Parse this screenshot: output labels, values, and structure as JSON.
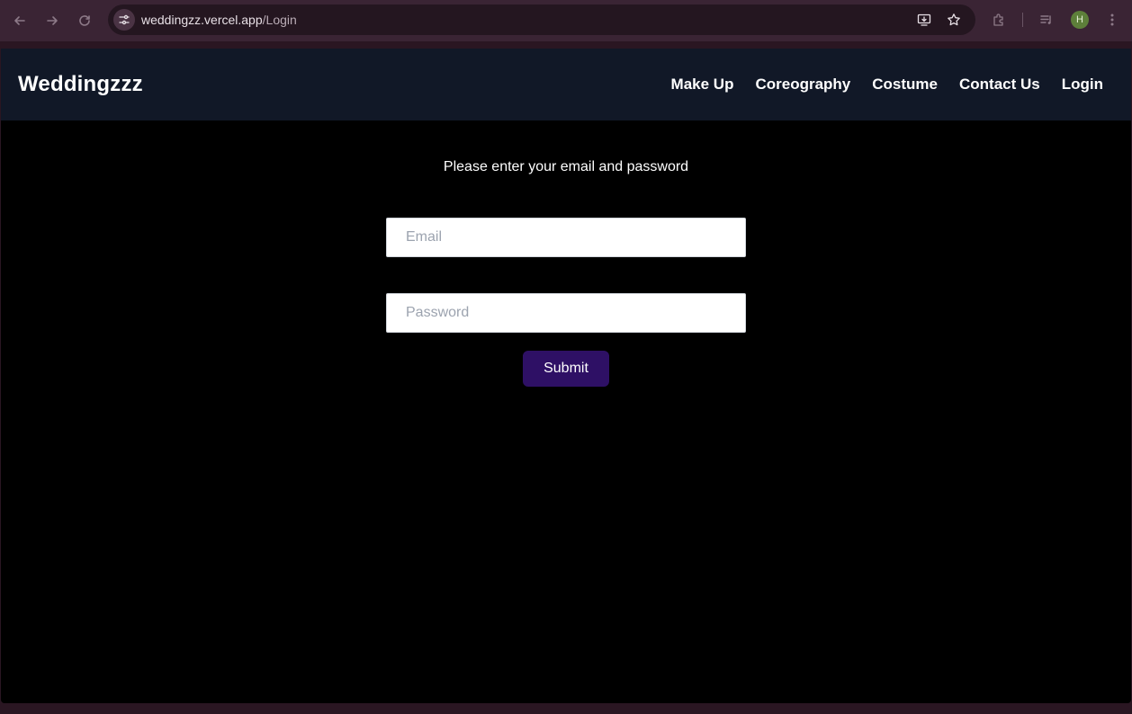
{
  "browser": {
    "url_host": "weddingzz.vercel.app",
    "url_path": "/Login",
    "profile_initial": "H",
    "icons": [
      "back-icon",
      "forward-icon",
      "reload-icon",
      "site-info-icon",
      "install-app-icon",
      "bookmark-star-icon",
      "extensions-icon",
      "reading-list-icon",
      "menu-dots-icon"
    ]
  },
  "navbar": {
    "brand": "Weddingzzz",
    "links": [
      "Make Up",
      "Coreography",
      "Costume",
      "Contact Us",
      "Login"
    ]
  },
  "login": {
    "prompt": "Please enter your email and password",
    "email_placeholder": "Email",
    "email_value": "",
    "password_placeholder": "Password",
    "password_value": "",
    "submit_label": "Submit"
  },
  "colors": {
    "navbar_bg": "#111827",
    "page_bg": "#000000",
    "submit_bg": "#2e1065",
    "chrome_bg": "#3a2434"
  }
}
